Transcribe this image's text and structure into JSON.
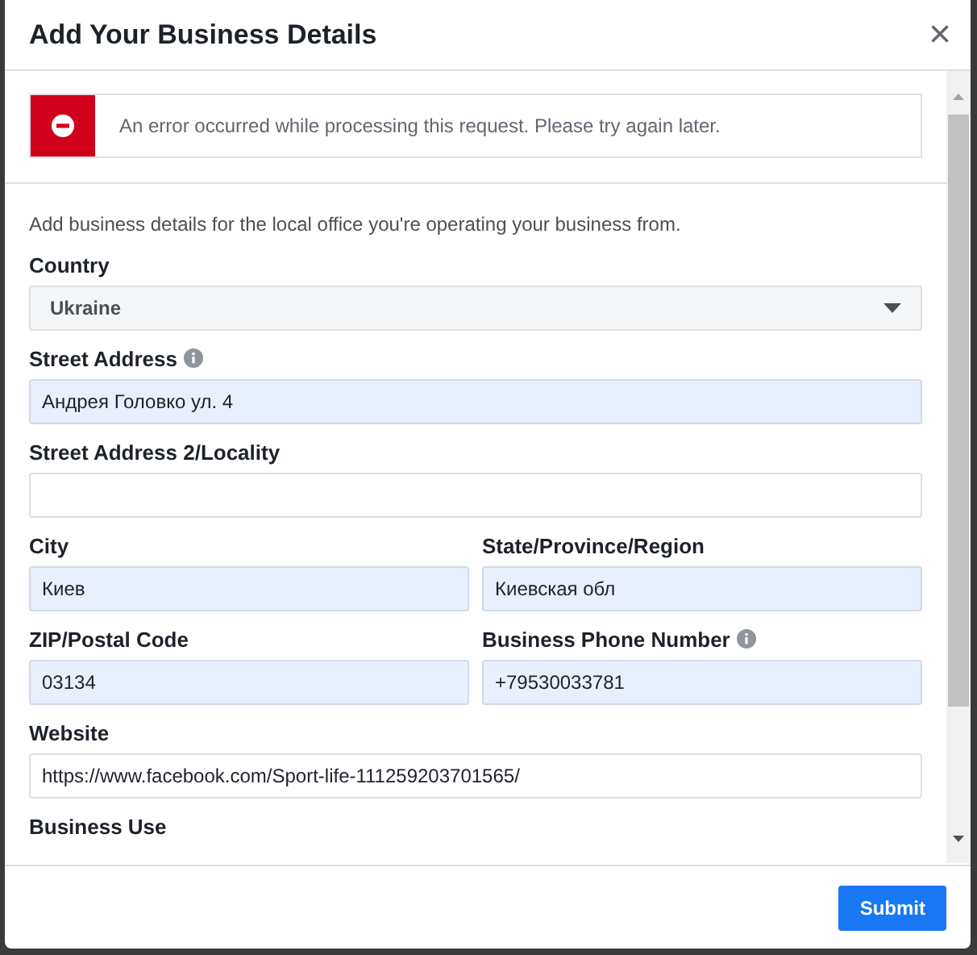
{
  "dialog": {
    "title": "Add Your Business Details",
    "close": "×"
  },
  "error": {
    "message": "An error occurred while processing this request. Please try again later."
  },
  "description": "Add business details for the local office you're operating your business from.",
  "rows": [
    [
      {
        "kind": "select",
        "label": "Country",
        "value": "Ukraine",
        "info": false
      }
    ],
    [
      {
        "kind": "text",
        "label": "Street Address",
        "value": "Андрея Головко ул. 4",
        "info": true,
        "autofilled": true
      }
    ],
    [
      {
        "kind": "text",
        "label": "Street Address 2/Locality",
        "info": false,
        "autofilled": false
      }
    ],
    [
      {
        "kind": "text",
        "label": "City",
        "value": "Киев",
        "info": false,
        "autofilled": true
      },
      {
        "kind": "text",
        "label": "State/Province/Region",
        "value": "Киевская обл",
        "info": false,
        "autofilled": true
      }
    ],
    [
      {
        "kind": "text",
        "label": "ZIP/Postal Code",
        "value": "03134",
        "info": false,
        "autofilled": true
      },
      {
        "kind": "text",
        "label": "Business Phone Number",
        "value": "+79530033781",
        "info": true,
        "autofilled": true
      }
    ],
    [
      {
        "kind": "text",
        "label": "Website",
        "value": "https://www.facebook.com/Sport-life-111259203701565/",
        "info": false,
        "autofilled": false
      }
    ],
    [
      {
        "kind": "heading",
        "label": "Business Use"
      }
    ]
  ],
  "submit": "Submit"
}
